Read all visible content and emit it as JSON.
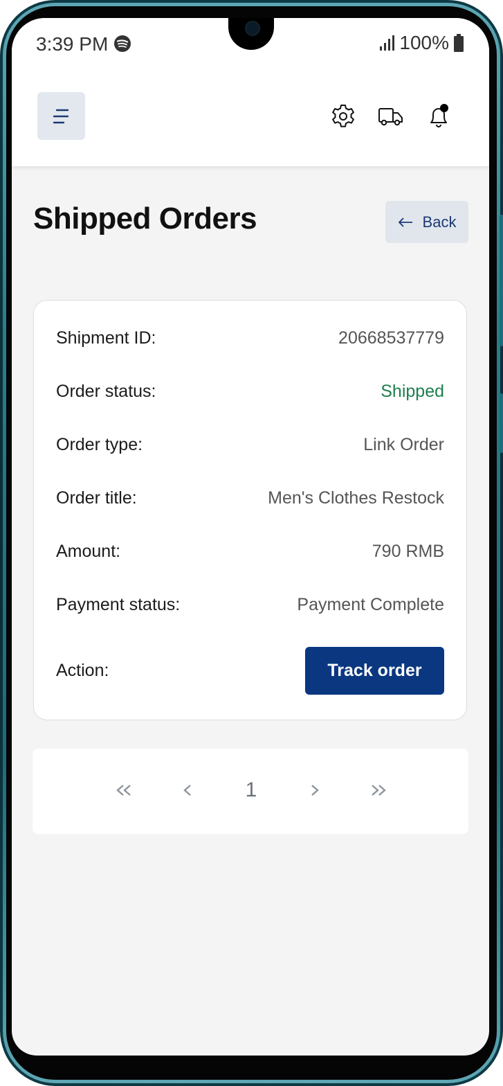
{
  "status_bar": {
    "time": "3:39 PM",
    "battery": "100%",
    "icons": [
      "spotify-icon",
      "signal-icon",
      "battery-icon"
    ]
  },
  "header": {
    "icons": [
      "menu-icon",
      "gear-icon",
      "truck-icon",
      "bell-icon"
    ],
    "notification_dot": true
  },
  "page": {
    "title": "Shipped Orders",
    "back_label": "Back"
  },
  "order": {
    "shipment_id_label": "Shipment ID:",
    "shipment_id": "20668537779",
    "status_label": "Order status:",
    "status": "Shipped",
    "type_label": "Order type:",
    "type": "Link Order",
    "title_label": "Order title:",
    "title": "Men's Clothes Restock",
    "amount_label": "Amount:",
    "amount": "790 RMB",
    "payment_label": "Payment status:",
    "payment": "Payment Complete",
    "action_label": "Action:",
    "action_button": "Track order"
  },
  "pagination": {
    "current_page": "1",
    "icons": [
      "double-chevron-left-icon",
      "chevron-left-icon",
      "chevron-right-icon",
      "double-chevron-right-icon"
    ]
  },
  "colors": {
    "primary": "#0a3780",
    "success": "#1e7f4e",
    "background": "#f4f4f4",
    "button_secondary": "#e1e6ed"
  }
}
